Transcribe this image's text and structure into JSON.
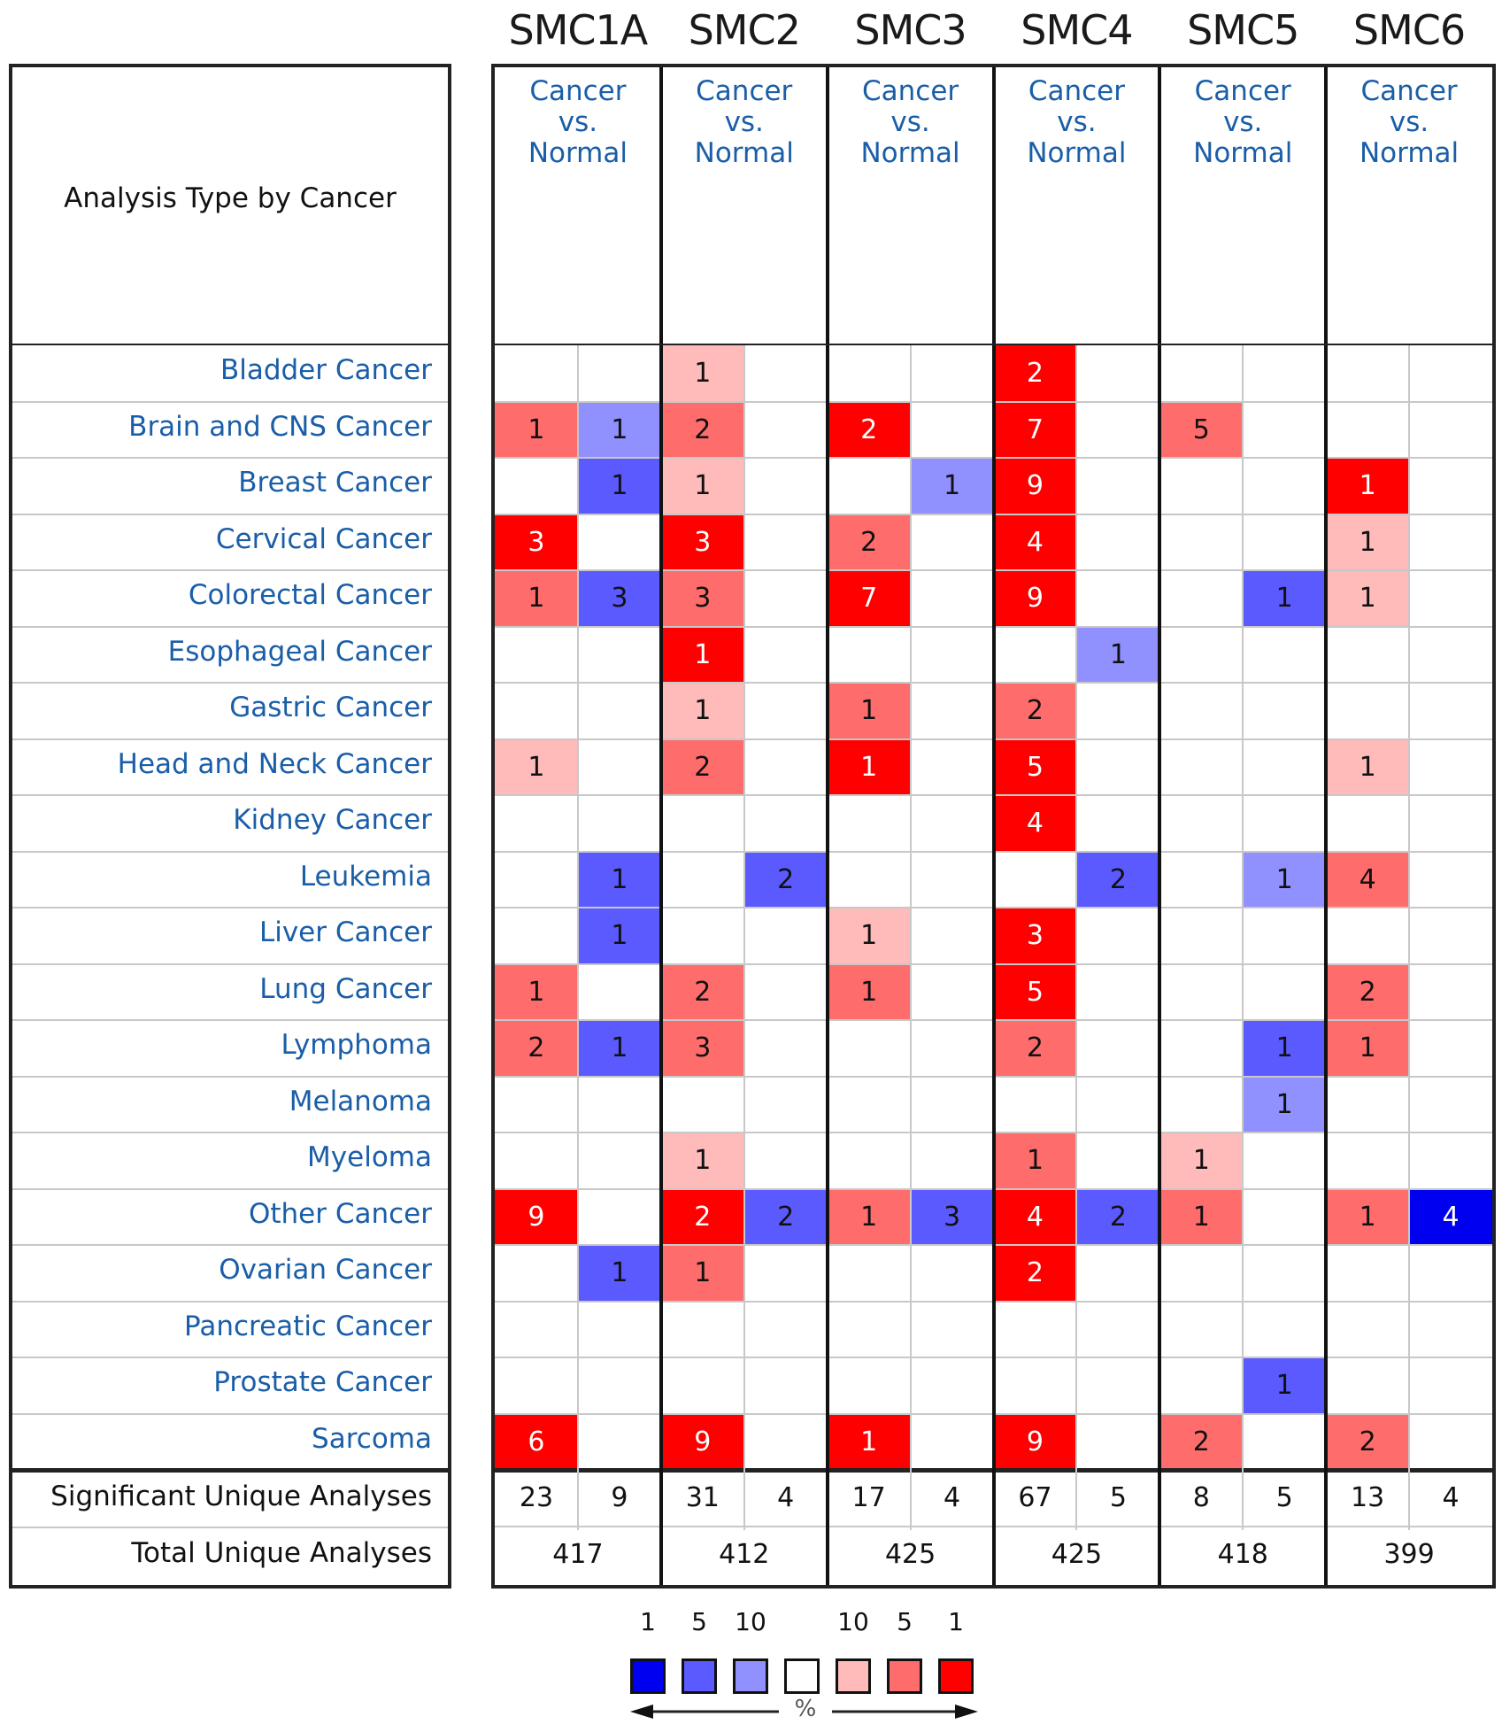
{
  "chart_data": {
    "type": "heatmap",
    "title": "",
    "row_header": "Analysis Type by Cancer",
    "column_subheader": "Cancer vs. Normal",
    "genes": [
      "SMC1A",
      "SMC2",
      "SMC3",
      "SMC4",
      "SMC5",
      "SMC6"
    ],
    "cell_encoding": "each gene has two sub-columns: up (red, left) and down (blue, right); value = number of significant analyses; color intensity = gene rank percentile bucket",
    "rows": [
      "Bladder Cancer",
      "Brain and CNS Cancer",
      "Breast Cancer",
      "Cervical Cancer",
      "Colorectal Cancer",
      "Esophageal Cancer",
      "Gastric Cancer",
      "Head and Neck Cancer",
      "Kidney Cancer",
      "Leukemia",
      "Liver Cancer",
      "Lung Cancer",
      "Lymphoma",
      "Melanoma",
      "Myeloma",
      "Other Cancer",
      "Ovarian Cancer",
      "Pancreatic Cancer",
      "Prostate Cancer",
      "Sarcoma"
    ],
    "cells": [
      [
        [
          null,
          null
        ],
        [
          [
            1,
            "up10"
          ],
          null
        ],
        [
          null,
          null
        ],
        [
          [
            2,
            "up1"
          ],
          null
        ],
        [
          null,
          null
        ],
        [
          null,
          null
        ]
      ],
      [
        [
          [
            1,
            "up5"
          ],
          [
            1,
            "dn10"
          ]
        ],
        [
          [
            2,
            "up5"
          ],
          null
        ],
        [
          [
            2,
            "up1"
          ],
          null
        ],
        [
          [
            7,
            "up1"
          ],
          null
        ],
        [
          [
            5,
            "up5"
          ],
          null
        ],
        [
          null,
          null
        ]
      ],
      [
        [
          null,
          [
            1,
            "dn5"
          ]
        ],
        [
          [
            1,
            "up10"
          ],
          null
        ],
        [
          null,
          [
            1,
            "dn10"
          ]
        ],
        [
          [
            9,
            "up1"
          ],
          null
        ],
        [
          null,
          null
        ],
        [
          [
            1,
            "up1"
          ],
          null
        ]
      ],
      [
        [
          [
            3,
            "up1"
          ],
          null
        ],
        [
          [
            3,
            "up1"
          ],
          null
        ],
        [
          [
            2,
            "up5"
          ],
          null
        ],
        [
          [
            4,
            "up1"
          ],
          null
        ],
        [
          null,
          null
        ],
        [
          [
            1,
            "up10"
          ],
          null
        ]
      ],
      [
        [
          [
            1,
            "up5"
          ],
          [
            3,
            "dn5"
          ]
        ],
        [
          [
            3,
            "up5"
          ],
          null
        ],
        [
          [
            7,
            "up1"
          ],
          null
        ],
        [
          [
            9,
            "up1"
          ],
          null
        ],
        [
          null,
          [
            1,
            "dn5"
          ]
        ],
        [
          [
            1,
            "up10"
          ],
          null
        ]
      ],
      [
        [
          null,
          null
        ],
        [
          [
            1,
            "up1"
          ],
          null
        ],
        [
          null,
          null
        ],
        [
          null,
          [
            1,
            "dn10"
          ]
        ],
        [
          null,
          null
        ],
        [
          null,
          null
        ]
      ],
      [
        [
          null,
          null
        ],
        [
          [
            1,
            "up10"
          ],
          null
        ],
        [
          [
            1,
            "up5"
          ],
          null
        ],
        [
          [
            2,
            "up5"
          ],
          null
        ],
        [
          null,
          null
        ],
        [
          null,
          null
        ]
      ],
      [
        [
          [
            1,
            "up10"
          ],
          null
        ],
        [
          [
            2,
            "up5"
          ],
          null
        ],
        [
          [
            1,
            "up1"
          ],
          null
        ],
        [
          [
            5,
            "up1"
          ],
          null
        ],
        [
          null,
          null
        ],
        [
          [
            1,
            "up10"
          ],
          null
        ]
      ],
      [
        [
          null,
          null
        ],
        [
          null,
          null
        ],
        [
          null,
          null
        ],
        [
          [
            4,
            "up1"
          ],
          null
        ],
        [
          null,
          null
        ],
        [
          null,
          null
        ]
      ],
      [
        [
          null,
          [
            1,
            "dn5"
          ]
        ],
        [
          null,
          [
            2,
            "dn5"
          ]
        ],
        [
          null,
          null
        ],
        [
          null,
          [
            2,
            "dn5"
          ]
        ],
        [
          null,
          [
            1,
            "dn10"
          ]
        ],
        [
          [
            4,
            "up5"
          ],
          null
        ]
      ],
      [
        [
          null,
          [
            1,
            "dn5"
          ]
        ],
        [
          null,
          null
        ],
        [
          [
            1,
            "up10"
          ],
          null
        ],
        [
          [
            3,
            "up1"
          ],
          null
        ],
        [
          null,
          null
        ],
        [
          null,
          null
        ]
      ],
      [
        [
          [
            1,
            "up5"
          ],
          null
        ],
        [
          [
            2,
            "up5"
          ],
          null
        ],
        [
          [
            1,
            "up5"
          ],
          null
        ],
        [
          [
            5,
            "up1"
          ],
          null
        ],
        [
          null,
          null
        ],
        [
          [
            2,
            "up5"
          ],
          null
        ]
      ],
      [
        [
          [
            2,
            "up5"
          ],
          [
            1,
            "dn5"
          ]
        ],
        [
          [
            3,
            "up5"
          ],
          null
        ],
        [
          null,
          null
        ],
        [
          [
            2,
            "up5"
          ],
          null
        ],
        [
          null,
          [
            1,
            "dn5"
          ]
        ],
        [
          [
            1,
            "up5"
          ],
          null
        ]
      ],
      [
        [
          null,
          null
        ],
        [
          null,
          null
        ],
        [
          null,
          null
        ],
        [
          null,
          null
        ],
        [
          null,
          [
            1,
            "dn10"
          ]
        ],
        [
          null,
          null
        ]
      ],
      [
        [
          null,
          null
        ],
        [
          [
            1,
            "up10"
          ],
          null
        ],
        [
          null,
          null
        ],
        [
          [
            1,
            "up5"
          ],
          null
        ],
        [
          [
            1,
            "up10"
          ],
          null
        ],
        [
          null,
          null
        ]
      ],
      [
        [
          [
            9,
            "up1"
          ],
          null
        ],
        [
          [
            2,
            "up1"
          ],
          [
            2,
            "dn5"
          ]
        ],
        [
          [
            1,
            "up5"
          ],
          [
            3,
            "dn5"
          ]
        ],
        [
          [
            4,
            "up1"
          ],
          [
            2,
            "dn5"
          ]
        ],
        [
          [
            1,
            "up5"
          ],
          null
        ],
        [
          [
            1,
            "up5"
          ],
          [
            4,
            "dn1"
          ]
        ]
      ],
      [
        [
          null,
          [
            1,
            "dn5"
          ]
        ],
        [
          [
            1,
            "up5"
          ],
          null
        ],
        [
          null,
          null
        ],
        [
          [
            2,
            "up1"
          ],
          null
        ],
        [
          null,
          null
        ],
        [
          null,
          null
        ]
      ],
      [
        [
          null,
          null
        ],
        [
          null,
          null
        ],
        [
          null,
          null
        ],
        [
          null,
          null
        ],
        [
          null,
          null
        ],
        [
          null,
          null
        ]
      ],
      [
        [
          null,
          null
        ],
        [
          null,
          null
        ],
        [
          null,
          null
        ],
        [
          null,
          null
        ],
        [
          null,
          [
            1,
            "dn5"
          ]
        ],
        [
          null,
          null
        ]
      ],
      [
        [
          [
            6,
            "up1"
          ],
          null
        ],
        [
          [
            9,
            "up1"
          ],
          null
        ],
        [
          [
            1,
            "up1"
          ],
          null
        ],
        [
          [
            9,
            "up1"
          ],
          null
        ],
        [
          [
            2,
            "up5"
          ],
          null
        ],
        [
          [
            2,
            "up5"
          ],
          null
        ]
      ]
    ],
    "significant_label": "Significant Unique Analyses",
    "significant": [
      [
        23,
        9
      ],
      [
        31,
        4
      ],
      [
        17,
        4
      ],
      [
        67,
        5
      ],
      [
        8,
        5
      ],
      [
        13,
        4
      ]
    ],
    "total_label": "Total Unique Analyses",
    "total": [
      417,
      412,
      425,
      425,
      418,
      399
    ],
    "legend": {
      "labels": [
        "1",
        "5",
        "10",
        "",
        "10",
        "5",
        "1"
      ],
      "buckets": [
        "dn1",
        "dn5",
        "dn10",
        "none",
        "up10",
        "up5",
        "up1"
      ],
      "axis_label": "%"
    },
    "colors": {
      "dn1": "#0000f0",
      "dn5": "#5a5aff",
      "dn10": "#9090ff",
      "none": "#ffffff",
      "up10": "#ffbaba",
      "up5": "#ff6c6c",
      "up1": "#ff0000"
    },
    "white_text_buckets": [
      "up1",
      "dn1"
    ]
  }
}
